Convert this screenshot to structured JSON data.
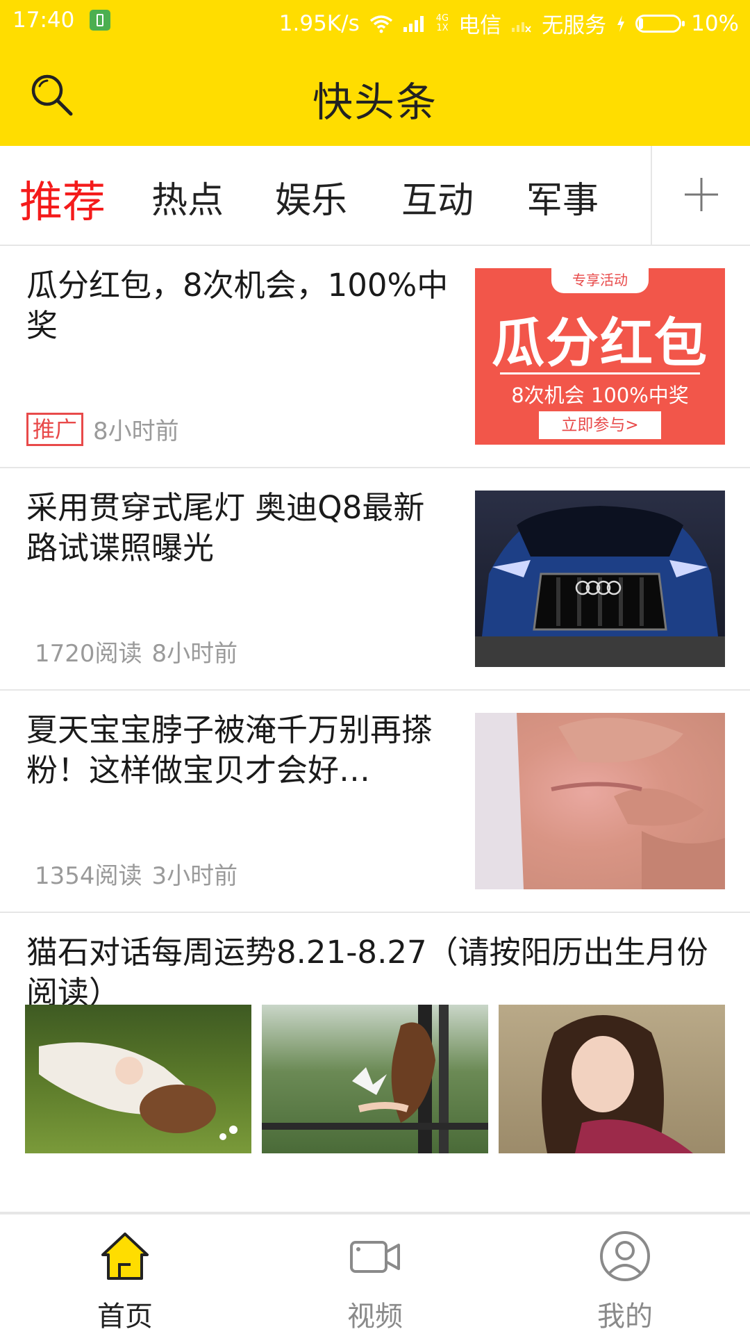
{
  "status_bar": {
    "time": "17:40",
    "speed": "1.95K/s",
    "net_type_top": "4G",
    "net_type_bottom": "1X",
    "carrier": "电信",
    "no_service": "无服务",
    "battery": "10%",
    "battery_level": 0.1
  },
  "header": {
    "title": "快头条",
    "search_icon": "search-icon",
    "brand_color": "#FFDD00"
  },
  "tabs": {
    "items": [
      {
        "label": "推荐",
        "active": true
      },
      {
        "label": "热点",
        "active": false
      },
      {
        "label": "娱乐",
        "active": false
      },
      {
        "label": "互动",
        "active": false
      },
      {
        "label": "军事",
        "active": false
      }
    ],
    "add_icon": "plus-icon",
    "active_color": "#f41b1b"
  },
  "feed": [
    {
      "title": "瓜分红包，8次机会，100%中奖",
      "badge": "推广",
      "time": "8小时前",
      "image": {
        "top_tag": "专享活动",
        "headline": "瓜分红包",
        "subline": "8次机会 100%中奖",
        "button": "立即参与>",
        "color": "#F2564A"
      }
    },
    {
      "title": "采用贯穿式尾灯 奥迪Q8最新路试谍照曝光",
      "reads": "1720阅读",
      "time": "8小时前",
      "image_icon": "car-photo"
    },
    {
      "title": "夏天宝宝脖子被淹千万别再搽粉！这样做宝贝才会好…",
      "reads": "1354阅读",
      "time": "3小时前",
      "image_icon": "baby-skin-photo"
    },
    {
      "title": "猫石对话每周运势8.21-8.27（请按阳历出生月份阅读）",
      "images": [
        "girl-on-grass-photo",
        "girl-paper-crane-photo",
        "girl-portrait-photo"
      ]
    }
  ],
  "bottom_nav": {
    "items": [
      {
        "label": "首页",
        "icon": "home-icon",
        "active": true
      },
      {
        "label": "视频",
        "icon": "video-icon",
        "active": false
      },
      {
        "label": "我的",
        "icon": "profile-icon",
        "active": false
      }
    ]
  }
}
